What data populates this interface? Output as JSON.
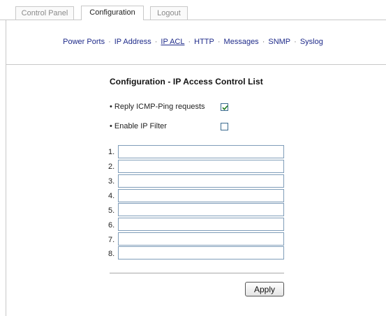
{
  "tabs": [
    {
      "label": "Control Panel",
      "active": false
    },
    {
      "label": "Configuration",
      "active": true
    },
    {
      "label": "Logout",
      "active": false
    }
  ],
  "subnav": {
    "items": [
      "Power Ports",
      "IP Address",
      "IP ACL",
      "HTTP",
      "Messages",
      "SNMP",
      "Syslog"
    ],
    "active": "IP ACL",
    "separator": "·"
  },
  "page": {
    "title": "Configuration - IP Access Control List"
  },
  "options": {
    "reply_icmp": {
      "label": "• Reply ICMP-Ping requests",
      "checked": true
    },
    "enable_filter": {
      "label": "• Enable IP Filter",
      "checked": false
    }
  },
  "acl": {
    "rows": [
      {
        "label": "1.",
        "value": ""
      },
      {
        "label": "2.",
        "value": ""
      },
      {
        "label": "3.",
        "value": ""
      },
      {
        "label": "4.",
        "value": ""
      },
      {
        "label": "5.",
        "value": ""
      },
      {
        "label": "6.",
        "value": ""
      },
      {
        "label": "7.",
        "value": ""
      },
      {
        "label": "8.",
        "value": ""
      }
    ]
  },
  "actions": {
    "apply_label": "Apply"
  }
}
